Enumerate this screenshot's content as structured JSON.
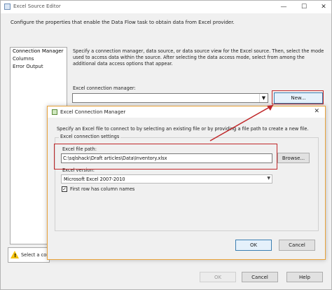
{
  "window": {
    "title": "Excel Source Editor",
    "controls": {
      "minimize": "—",
      "maximize": "☐",
      "close": "✕"
    },
    "description": "Configure the properties that enable the Data Flow task to obtain data from Excel provider."
  },
  "nav": {
    "items": [
      {
        "label": "Connection Manager"
      },
      {
        "label": "Columns"
      },
      {
        "label": "Error Output"
      }
    ]
  },
  "connection": {
    "description": "Specify a connection manager, data source, or data source view for the Excel source. Then, select the mode used to access data within the source. After selecting the data access mode, select from among the additional data access options that appear.",
    "manager_label": "Excel connection manager:",
    "manager_value": "",
    "new_button": "New..."
  },
  "warning": {
    "text": "Select a conne"
  },
  "footer": {
    "ok_button": "OK",
    "cancel_button": "Cancel",
    "help_button": "Help"
  },
  "dialog": {
    "title": "Excel Connection Manager",
    "close": "✕",
    "description": "Specify an Excel file to connect to by selecting an existing file or by providing a file path to create a new file.",
    "group_label": "Excel connection settings",
    "file_path_label": "Excel file path:",
    "file_path_value": "C:\\sqlshack\\Draft articles\\Data\\Inventory.xlsx",
    "browse_button": "Browse...",
    "version_label": "Excel version:",
    "version_value": "Microsoft Excel 2007-2010",
    "first_row_label": "First row has column names",
    "first_row_checked": "✓",
    "ok_button": "OK",
    "cancel_button": "Cancel"
  },
  "colors": {
    "highlight": "#c0282a",
    "dialog_border": "#e8a23a",
    "focus_border": "#3c7fb1"
  }
}
